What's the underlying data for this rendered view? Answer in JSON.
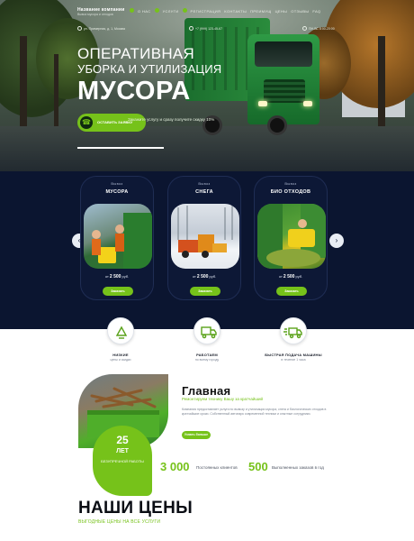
{
  "header": {
    "company_name": "Название компании",
    "company_tagline": "Вывоз мусора и отходов",
    "nav": [
      "О НАС",
      "УСЛУГИ",
      "РЕГИСТРАЦИЯ",
      "КОНТАКТЫ",
      "ПРЕИМУЩ",
      "ЦЕНЫ",
      "ОТЗЫВЫ",
      "FAQ"
    ],
    "address": "ул. Примерная, д. 1, Москва",
    "phone": "+7 (999) 123-45-67",
    "hours": "ПН-ВС 8:00-20:00"
  },
  "hero": {
    "title_line1": "ОПЕРАТИВНАЯ",
    "title_line2": "УБОРКА И УТИЛИЗАЦИЯ",
    "title_line3": "МУСОРА",
    "cta_label": "ОСТАВИТЬ ЗАЯВКУ",
    "cta_note": "Закажите услугу и сразу получите скидку 10%"
  },
  "services": {
    "cards": [
      {
        "kicker": "Вывоз",
        "title": "МУСОРА",
        "price_prefix": "от",
        "price": "2 500",
        "price_unit": "руб.",
        "button": "Заказать"
      },
      {
        "kicker": "Вывоз",
        "title": "СНЕГА",
        "price_prefix": "от",
        "price": "2 500",
        "price_unit": "руб.",
        "button": "Заказать"
      },
      {
        "kicker": "Вывоз",
        "title": "БИО ОТХОДОВ",
        "price_prefix": "от",
        "price": "2 500",
        "price_unit": "руб.",
        "button": "Заказать"
      }
    ],
    "arrow_left": "‹",
    "arrow_right": "›"
  },
  "features": [
    {
      "icon": "recycle-icon",
      "title": "НИЗКИЕ",
      "subtitle": "цены и скидки"
    },
    {
      "icon": "truck-icon",
      "title": "РАБОТАЕМ",
      "subtitle": "по всему городу"
    },
    {
      "icon": "fast-truck-icon",
      "title": "БЫСТРАЯ ПОДАЧА МАШИНЫ",
      "subtitle": "в течение 1 часа"
    }
  ],
  "about": {
    "heading": "Главная",
    "subheading": "Ремонтируем технику Вашу за кратчайший",
    "paragraph": "Компания предоставляет услуги по вывозу и утилизации мусора, снега и биологических отходов в кратчайшие сроки. Собственный автопарк современной техники и опытные сотрудники.",
    "more_button": "Узнать больше",
    "badge_number": "25",
    "badge_unit": "ЛЕТ",
    "badge_text": "БЕЗУПРЕЧНОЙ РАБОТЫ",
    "stats": [
      {
        "value": "3 000",
        "label": "Постоянных клиентов"
      },
      {
        "value": "500",
        "label": "Выполненных заказов в год"
      }
    ]
  },
  "prices": {
    "heading": "НАШИ ЦЕНЫ",
    "subheading": "ВЫГОДНЫЕ ЦЕНЫ НА ВСЕ УСЛУГИ"
  },
  "colors": {
    "accent": "#76c21a",
    "dark_bg": "#0b1530"
  }
}
